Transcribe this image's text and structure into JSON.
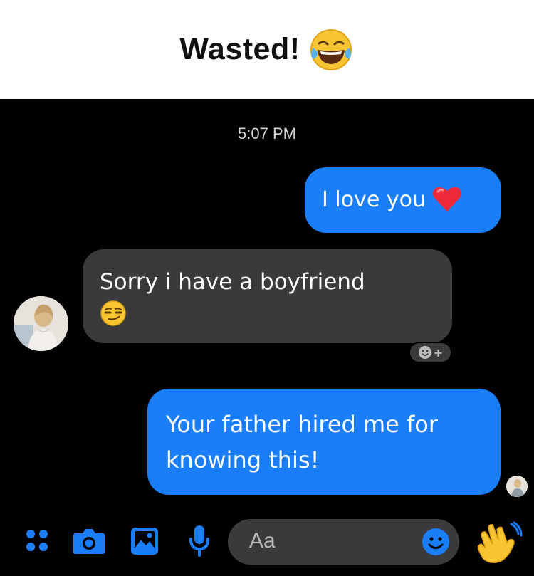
{
  "header": {
    "title": "Wasted!",
    "emoji": "tears-of-joy-emoji"
  },
  "chat": {
    "timestamp": "5:07 PM",
    "messages": [
      {
        "direction": "outgoing",
        "text": "I love you",
        "emoji": "red-heart-emoji"
      },
      {
        "direction": "incoming",
        "text": "Sorry i have a boyfriend",
        "emoji": "smirking-face-emoji"
      },
      {
        "direction": "outgoing",
        "text_lines": [
          "Your father hired me for",
          "knowing this!"
        ]
      }
    ]
  },
  "composer": {
    "placeholder": "Aa",
    "icons": [
      "menu-dots-icon",
      "camera-icon",
      "gallery-icon",
      "microphone-icon",
      "emoji-icon",
      "waving-hand-icon"
    ]
  },
  "colors": {
    "outgoing_bubble": "#1a7ef9",
    "incoming_bubble": "#3a3a3c",
    "accent": "#1a7ef9",
    "background": "#000000"
  }
}
